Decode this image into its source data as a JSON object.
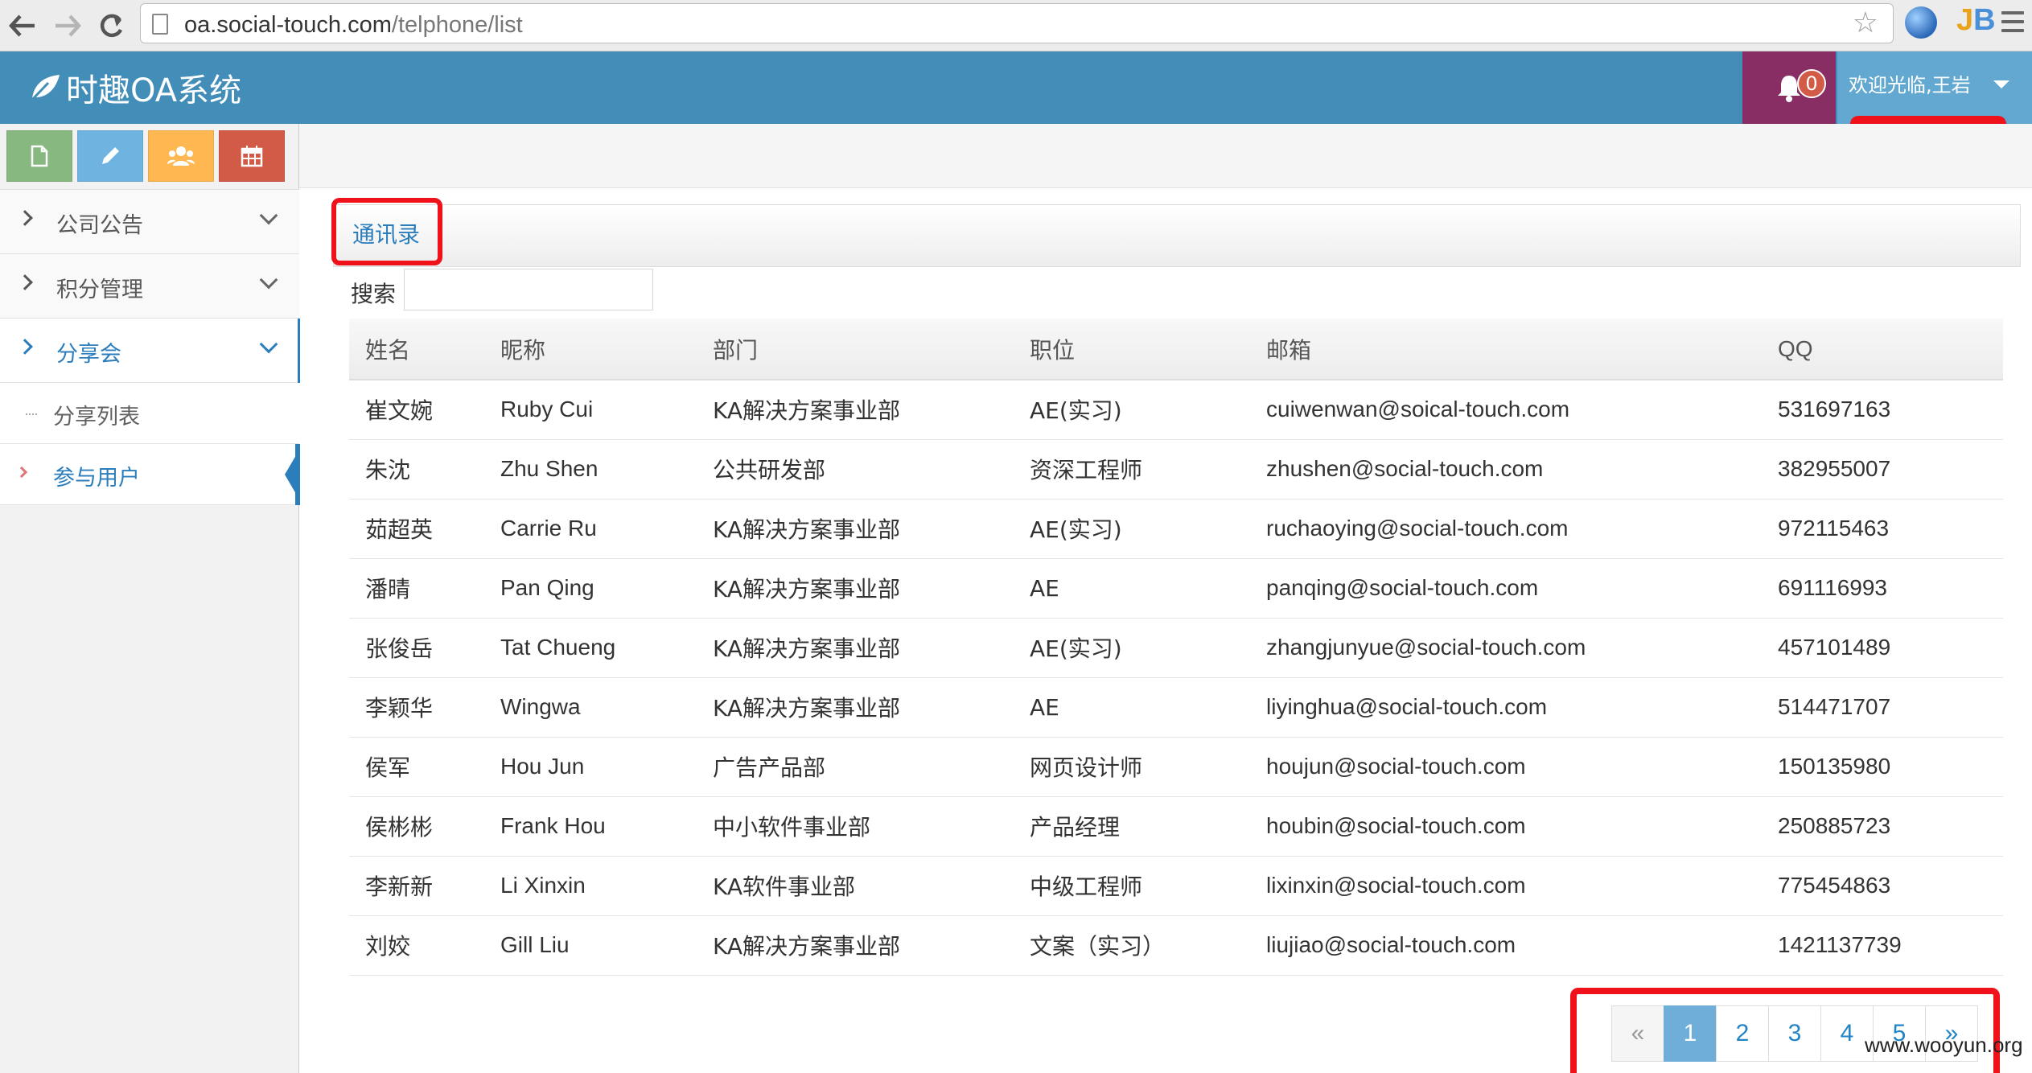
{
  "browser": {
    "url_host": "oa.social-touch.com",
    "url_path": "/telphone/list"
  },
  "header": {
    "brand": "时趣OA系统",
    "notification_count": "0",
    "welcome": "欢迎光临,王岩",
    "colors": {
      "header_bg": "#438eb9",
      "bell_bg": "#892e65",
      "user_bg": "#62a8d1",
      "badge": "#d15b47"
    }
  },
  "shortcuts": [
    {
      "icon": "document-icon",
      "color": "#87b87f"
    },
    {
      "icon": "pencil-icon",
      "color": "#6fb3e0"
    },
    {
      "icon": "users-icon",
      "color": "#ffb752"
    },
    {
      "icon": "calendar-icon",
      "color": "#d15b47"
    }
  ],
  "sidebar": {
    "items": [
      {
        "label": "公司公告"
      },
      {
        "label": "积分管理"
      },
      {
        "label": "分享会",
        "active": true
      }
    ],
    "subitems": [
      {
        "label": "分享列表"
      },
      {
        "label": "参与用户",
        "active": true
      }
    ]
  },
  "main": {
    "title": "通讯录",
    "search_label": "搜索",
    "search_value": ""
  },
  "table": {
    "headers": [
      "姓名",
      "昵称",
      "部门",
      "职位",
      "邮箱",
      "QQ"
    ],
    "rows": [
      [
        "崔文婉",
        "Ruby Cui",
        "KA解决方案事业部",
        "AE(实习)",
        "cuiwenwan@soical-touch.com",
        "531697163"
      ],
      [
        "朱沈",
        "Zhu Shen",
        "公共研发部",
        "资深工程师",
        "zhushen@social-touch.com",
        "382955007"
      ],
      [
        "茹超英",
        "Carrie Ru",
        "KA解决方案事业部",
        "AE(实习)",
        "ruchaoying@social-touch.com",
        "972115463"
      ],
      [
        "潘晴",
        "Pan Qing",
        "KA解决方案事业部",
        "AE",
        "panqing@social-touch.com",
        "691116993"
      ],
      [
        "张俊岳",
        "Tat Chueng",
        "KA解决方案事业部",
        "AE(实习)",
        "zhangjunyue@social-touch.com",
        "457101489"
      ],
      [
        "李颖华",
        "Wingwa",
        "KA解决方案事业部",
        "AE",
        "liyinghua@social-touch.com",
        "514471707"
      ],
      [
        "侯军",
        "Hou Jun",
        "广告产品部",
        "网页设计师",
        "houjun@social-touch.com",
        "150135980"
      ],
      [
        "侯彬彬",
        "Frank Hou",
        "中小软件事业部",
        "产品经理",
        "houbin@social-touch.com",
        "250885723"
      ],
      [
        "李新新",
        "Li Xinxin",
        "KA软件事业部",
        "中级工程师",
        "lixinxin@social-touch.com",
        "775454863"
      ],
      [
        "刘姣",
        "Gill Liu",
        "KA解决方案事业部",
        "文案（实习）",
        "liujiao@social-touch.com",
        "1421137739"
      ]
    ]
  },
  "pagination": {
    "prev": "«",
    "pages": [
      "1",
      "2",
      "3",
      "4",
      "5"
    ],
    "current": "1",
    "next": "»"
  },
  "watermark": "www.wooyun.org"
}
